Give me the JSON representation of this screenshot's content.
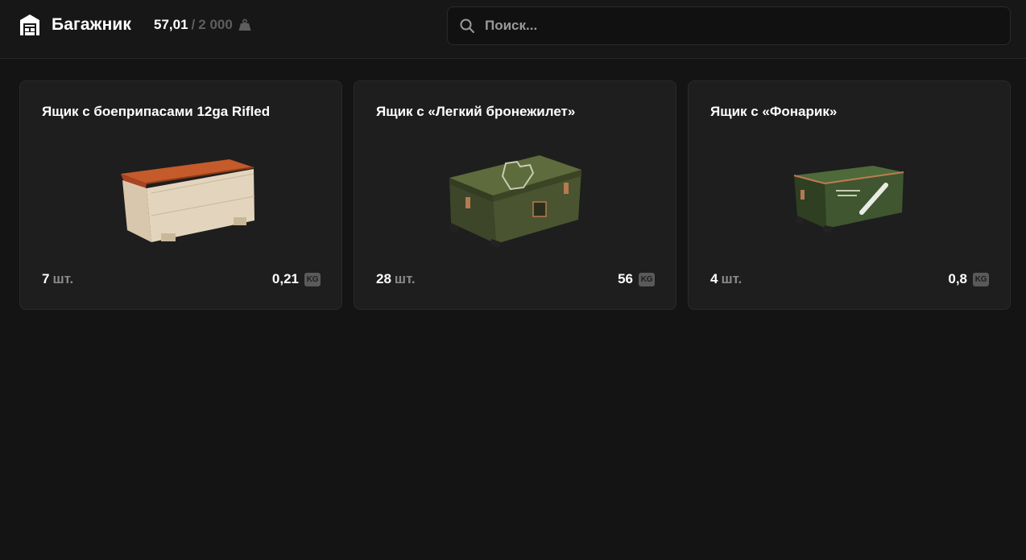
{
  "header": {
    "title": "Багажник",
    "weight_current": "57,01",
    "weight_separator": "/",
    "weight_max": "2 000",
    "icons": {
      "brand": "warehouse-icon",
      "weight": "weight-icon"
    }
  },
  "search": {
    "placeholder": "Поиск...",
    "value": "",
    "icon": "search-icon"
  },
  "colors": {
    "background": "#141414",
    "header": "#171717",
    "card": "#1e1e1e",
    "muted": "#5e5e5e"
  },
  "items": [
    {
      "title": "Ящик с боеприпасами 12ga Rifled",
      "qty": "7",
      "qty_unit": "шт.",
      "weight": "0,21",
      "weight_unit": "KG",
      "image": "wooden-ammo-crate"
    },
    {
      "title": "Ящик с «Легкий бронежилет»",
      "qty": "28",
      "qty_unit": "шт.",
      "weight": "56",
      "weight_unit": "KG",
      "image": "military-armor-crate"
    },
    {
      "title": "Ящик с «Фонарик»",
      "qty": "4",
      "qty_unit": "шт.",
      "weight": "0,8",
      "weight_unit": "KG",
      "image": "military-flashlight-crate"
    }
  ]
}
